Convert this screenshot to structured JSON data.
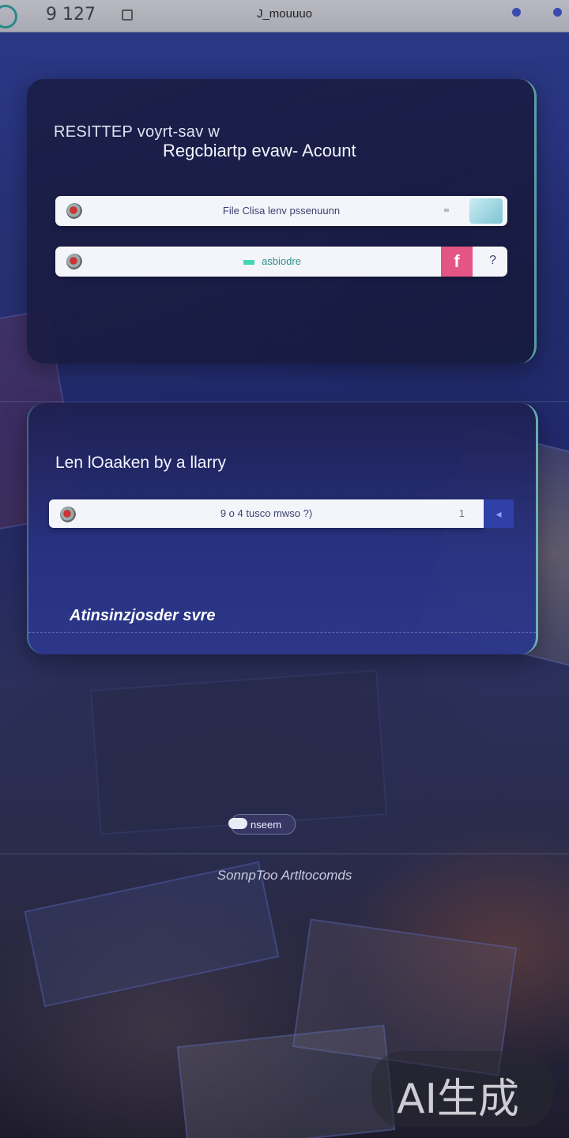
{
  "status_bar": {
    "time": "9 127",
    "carrier": "J_mouuuo"
  },
  "register_card": {
    "heading": "RESITTEP voyrt-sav w",
    "subheading": "Regcbiartp evaw- Acount",
    "field_1_text": "File Clisa lenv pssenuunn",
    "field_2_text": "asbiodre",
    "field_2_social": "f",
    "field_2_help": "?"
  },
  "library_card": {
    "title": "Len lOaaken by a llarry",
    "field_text": "9 o 4 tusco mwso ?)",
    "field_tail": "1",
    "footer": "Atinsinzjosder svre"
  },
  "bottom_pill": {
    "label": "nseem"
  },
  "footer_link": "SonnpToo Artltocomds",
  "watermark": "AI生成",
  "colors": {
    "accent": "#e25585",
    "teal": "#45d6b8",
    "card_bg": "#1e2050",
    "status_bg": "#b3b3be"
  }
}
